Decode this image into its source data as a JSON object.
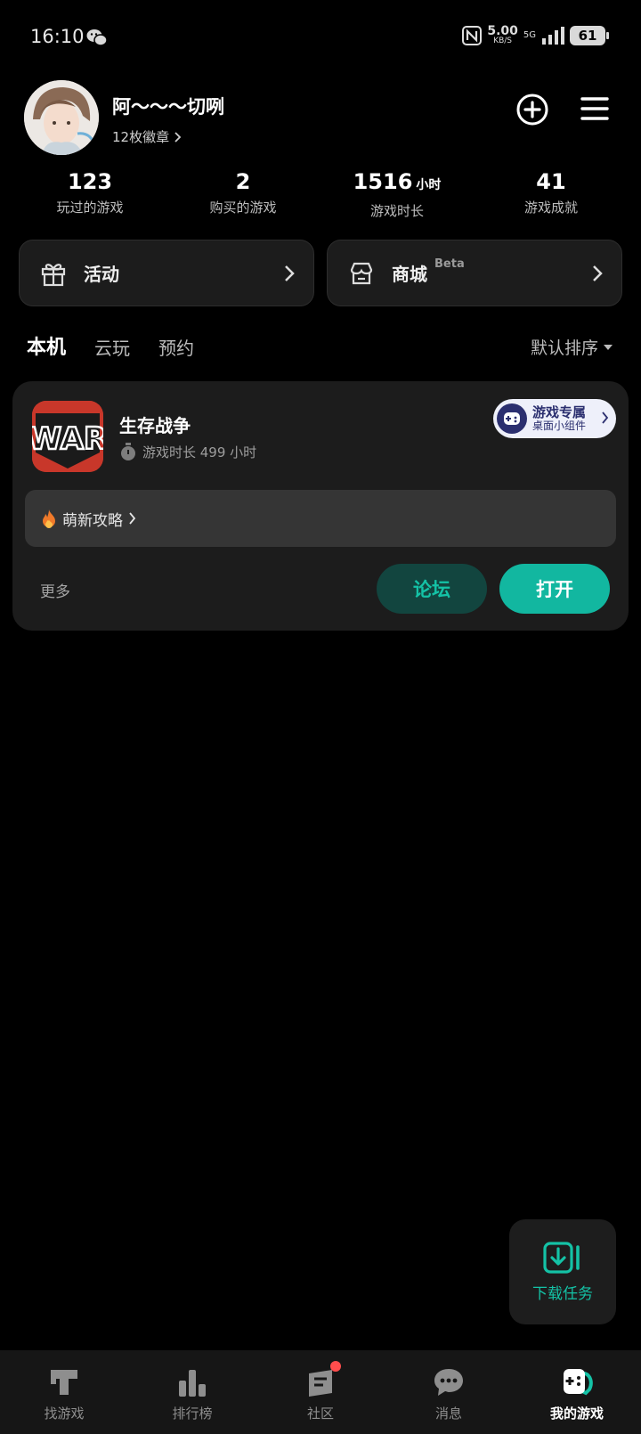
{
  "status_bar": {
    "time": "16:10",
    "net_speed": "5.00",
    "net_speed_unit": "KB/S",
    "network_type": "5G",
    "battery": "61"
  },
  "profile": {
    "nickname": "阿～～～切咧",
    "badges_label": "12枚徽章"
  },
  "stats": [
    {
      "value": "123",
      "unit": "",
      "label": "玩过的游戏"
    },
    {
      "value": "2",
      "unit": "",
      "label": "购买的游戏"
    },
    {
      "value": "1516",
      "unit": "小时",
      "label": "游戏时长"
    },
    {
      "value": "41",
      "unit": "",
      "label": "游戏成就"
    }
  ],
  "quick_cards": {
    "activity_label": "活动",
    "store_label": "商城",
    "store_badge": "Beta"
  },
  "tabs": {
    "items": [
      "本机",
      "云玩",
      "预约"
    ],
    "active": "本机",
    "sort_label": "默认排序"
  },
  "game": {
    "name": "生存战争",
    "icon_text": "WAR",
    "playtime": "游戏时长 499 小时",
    "widget_line1": "游戏专属",
    "widget_line2": "桌面小组件",
    "guide": "萌新攻略",
    "more": "更多",
    "forum": "论坛",
    "open": "打开"
  },
  "download_task": {
    "label": "下载任务"
  },
  "bottom_nav": {
    "items": [
      "找游戏",
      "排行榜",
      "社区",
      "消息",
      "我的游戏"
    ],
    "active": "我的游戏"
  },
  "colors": {
    "accent": "#12b7a0",
    "forum_bg": "#12453f",
    "card_bg": "#1c1c1c",
    "badge": "#ff4d4d"
  }
}
